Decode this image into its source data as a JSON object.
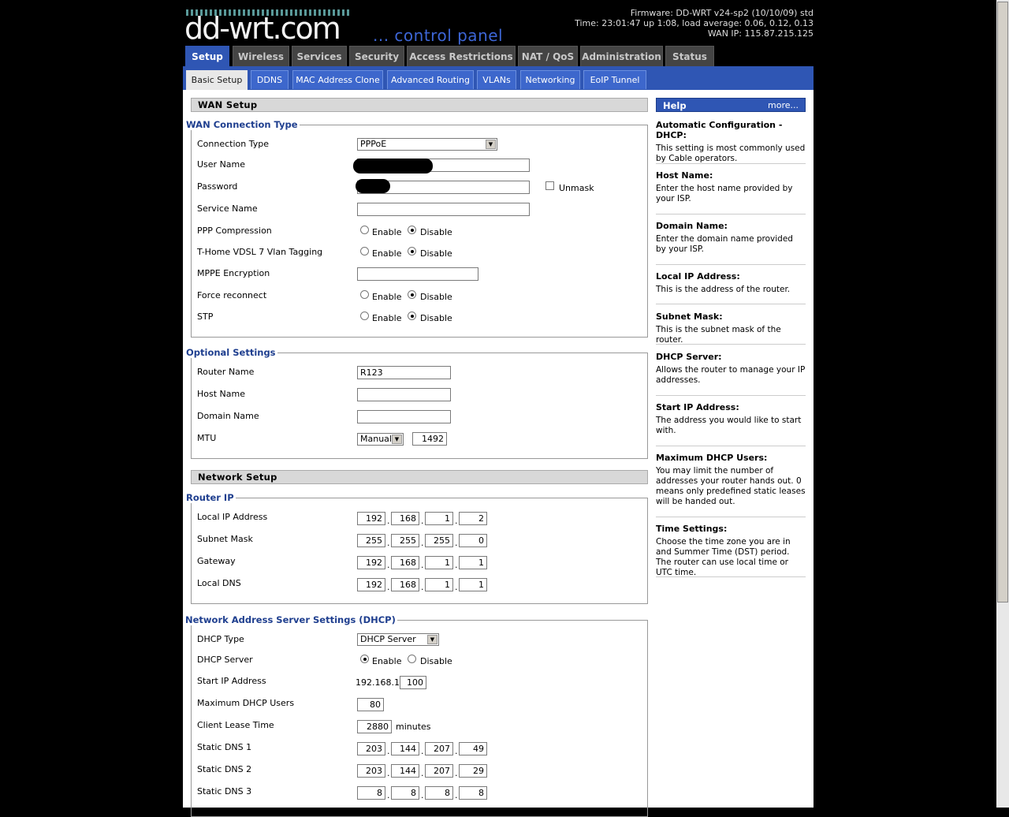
{
  "header": {
    "logo": "dd-wrt.com",
    "tagline": "... control panel",
    "firmware": "Firmware: DD-WRT v24-sp2 (10/10/09) std",
    "time": "Time: 23:01:47 up 1:08, load average: 0.06, 0.12, 0.13",
    "wan_ip": "WAN IP: 115.87.215.125"
  },
  "tabs": [
    "Setup",
    "Wireless",
    "Services",
    "Security",
    "Access Restrictions",
    "NAT / QoS",
    "Administration",
    "Status"
  ],
  "subtabs": [
    "Basic Setup",
    "DDNS",
    "MAC Address Clone",
    "Advanced Routing",
    "VLANs",
    "Networking",
    "EoIP Tunnel"
  ],
  "wan": {
    "section_title": "WAN Setup",
    "legend": "WAN Connection Type",
    "connection_type_label": "Connection Type",
    "connection_type": "PPPoE",
    "user_name_label": "User Name",
    "password_label": "Password",
    "unmask_label": "Unmask",
    "service_name_label": "Service Name",
    "ppp_compression_label": "PPP Compression",
    "vlan_tagging_label": "T-Home VDSL 7 Vlan Tagging",
    "mppe_label": "MPPE Encryption",
    "force_reconnect_label": "Force reconnect",
    "stp_label": "STP",
    "enable": "Enable",
    "disable": "Disable"
  },
  "optional": {
    "legend": "Optional Settings",
    "router_name_label": "Router Name",
    "router_name": "R123",
    "host_name_label": "Host Name",
    "domain_name_label": "Domain Name",
    "mtu_label": "MTU",
    "mtu_mode": "Manual",
    "mtu_value": "1492"
  },
  "network": {
    "section_title": "Network Setup",
    "legend": "Router IP",
    "local_ip_label": "Local IP Address",
    "local_ip": [
      "192",
      "168",
      "1",
      "2"
    ],
    "subnet_label": "Subnet Mask",
    "subnet": [
      "255",
      "255",
      "255",
      "0"
    ],
    "gateway_label": "Gateway",
    "gateway": [
      "192",
      "168",
      "1",
      "1"
    ],
    "local_dns_label": "Local DNS",
    "local_dns": [
      "192",
      "168",
      "1",
      "1"
    ]
  },
  "dhcp": {
    "legend": "Network Address Server Settings (DHCP)",
    "type_label": "DHCP Type",
    "type": "DHCP Server",
    "server_label": "DHCP Server",
    "start_ip_label": "Start IP Address",
    "start_ip_prefix": "192.168.1.",
    "start_ip_last": "100",
    "max_users_label": "Maximum DHCP Users",
    "max_users": "80",
    "lease_label": "Client Lease Time",
    "lease": "2880",
    "lease_unit": "minutes",
    "dns1_label": "Static DNS 1",
    "dns1": [
      "203",
      "144",
      "207",
      "49"
    ],
    "dns2_label": "Static DNS 2",
    "dns2": [
      "203",
      "144",
      "207",
      "29"
    ],
    "dns3_label": "Static DNS 3",
    "dns3": [
      "8",
      "8",
      "8",
      "8"
    ]
  },
  "help": {
    "title": "Help",
    "more": "more...",
    "items": [
      {
        "title": "Automatic Configuration - DHCP:",
        "body": "This setting is most commonly used by Cable operators."
      },
      {
        "title": "Host Name:",
        "body": "Enter the host name provided by your ISP."
      },
      {
        "title": "Domain Name:",
        "body": "Enter the domain name provided by your ISP."
      },
      {
        "title": "Local IP Address:",
        "body": "This is the address of the router."
      },
      {
        "title": "Subnet Mask:",
        "body": "This is the subnet mask of the router."
      },
      {
        "title": "DHCP Server:",
        "body": "Allows the router to manage your IP addresses."
      },
      {
        "title": "Start IP Address:",
        "body": "The address you would like to start with."
      },
      {
        "title": "Maximum DHCP Users:",
        "body": "You may limit the number of addresses your router hands out. 0 means only predefined static leases will be handed out."
      },
      {
        "title": "Time Settings:",
        "body": "Choose the time zone you are in and Summer Time (DST) period. The router can use local time or UTC time."
      }
    ]
  }
}
